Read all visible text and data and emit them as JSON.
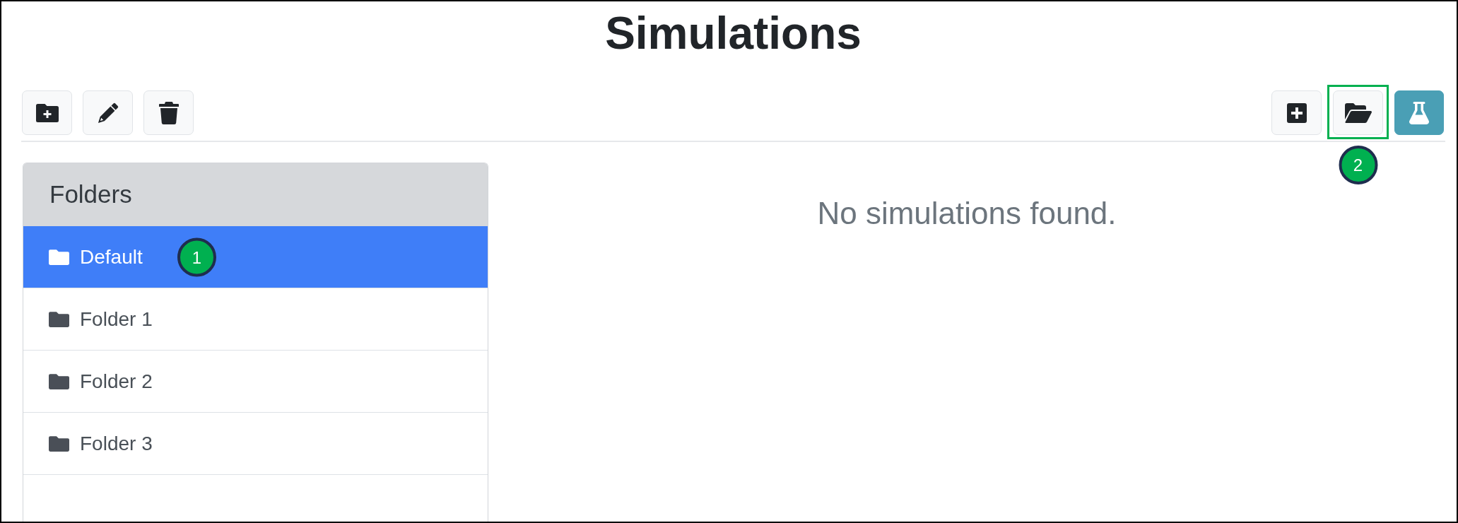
{
  "title": "Simulations",
  "toolbar_right": [
    {
      "highlighted": false
    },
    {
      "highlighted": true,
      "callout": "2"
    },
    {
      "highlighted": false
    }
  ],
  "folders": {
    "heading": "Folders",
    "items": [
      {
        "label": "Default",
        "selected": true,
        "callout": "1"
      },
      {
        "label": "Folder 1",
        "selected": false
      },
      {
        "label": "Folder 2",
        "selected": false
      },
      {
        "label": "Folder 3",
        "selected": false
      }
    ]
  },
  "empty_message": "No simulations found."
}
